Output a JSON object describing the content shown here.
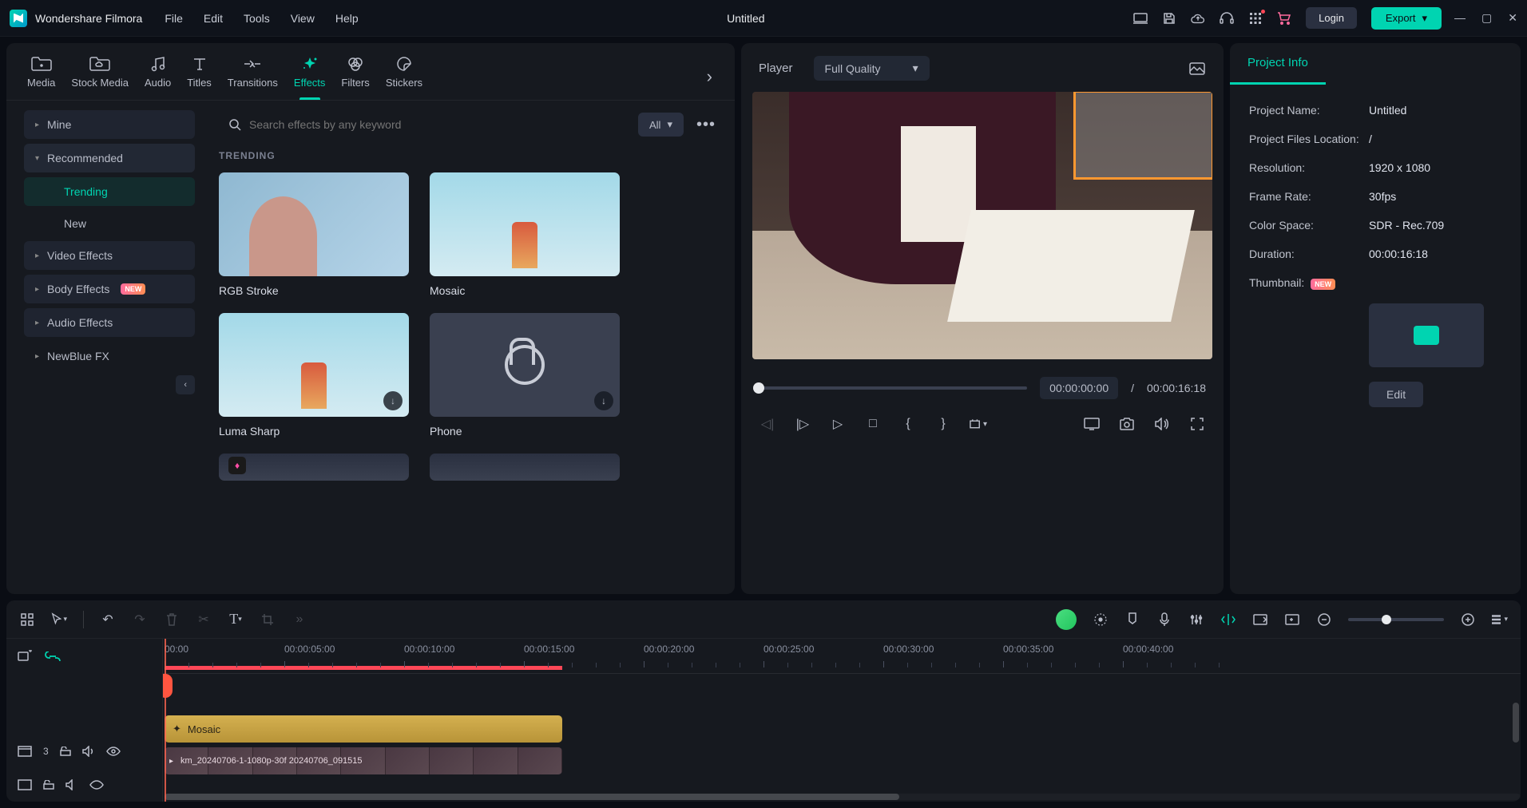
{
  "app": {
    "name": "Wondershare Filmora",
    "document": "Untitled"
  },
  "menu": [
    "File",
    "Edit",
    "Tools",
    "View",
    "Help"
  ],
  "titlebar": {
    "login": "Login",
    "export": "Export"
  },
  "mediaTabs": [
    "Media",
    "Stock Media",
    "Audio",
    "Titles",
    "Transitions",
    "Effects",
    "Filters",
    "Stickers"
  ],
  "mediaActive": "Effects",
  "sidebar": {
    "mine": "Mine",
    "recommended": "Recommended",
    "trending": "Trending",
    "new": "New",
    "videoEffects": "Video Effects",
    "bodyEffects": "Body Effects",
    "audioEffects": "Audio Effects",
    "newblue": "NewBlue FX",
    "badge": "NEW"
  },
  "search": {
    "placeholder": "Search effects by any keyword",
    "filter": "All"
  },
  "section": {
    "trending": "TRENDING"
  },
  "effects": {
    "rgbStroke": "RGB Stroke",
    "mosaic": "Mosaic",
    "lumaSharp": "Luma Sharp",
    "phone": "Phone"
  },
  "player": {
    "label": "Player",
    "quality": "Full Quality",
    "cur": "00:00:00:00",
    "sep": "/",
    "total": "00:00:16:18"
  },
  "info": {
    "tab": "Project Info",
    "projectName_k": "Project Name:",
    "projectName_v": "Untitled",
    "filesLoc_k": "Project Files Location:",
    "filesLoc_v": "/",
    "resolution_k": "Resolution:",
    "resolution_v": "1920 x 1080",
    "frameRate_k": "Frame Rate:",
    "frameRate_v": "30fps",
    "colorSpace_k": "Color Space:",
    "colorSpace_v": "SDR - Rec.709",
    "duration_k": "Duration:",
    "duration_v": "00:00:16:18",
    "thumbnail_k": "Thumbnail:",
    "thumbnail_badge": "NEW",
    "edit": "Edit"
  },
  "timeline": {
    "ticks": [
      "00:00",
      "00:00:05:00",
      "00:00:10:00",
      "00:00:15:00",
      "00:00:20:00",
      "00:00:25:00",
      "00:00:30:00",
      "00:00:35:00",
      "00:00:40:00"
    ],
    "fxClip": "Mosaic",
    "vidClip": "km_20240706-1-1080p-30f 20240706_091515",
    "trackNum": "3"
  }
}
